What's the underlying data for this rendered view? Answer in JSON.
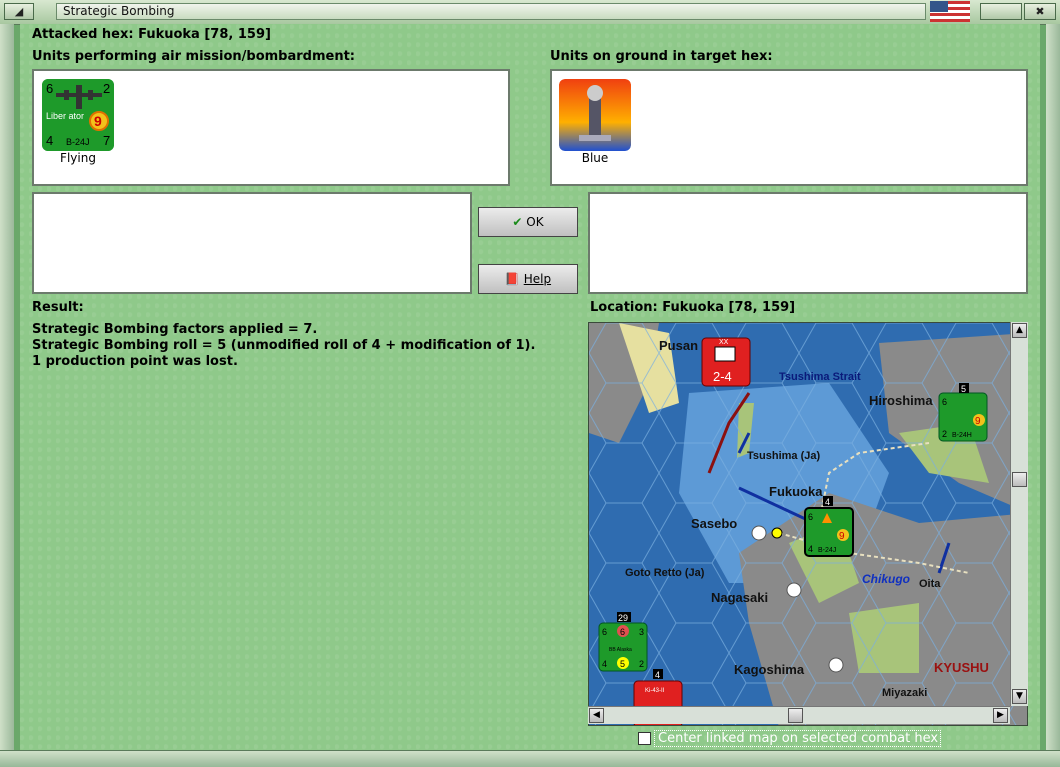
{
  "window": {
    "title": "Strategic Bombing"
  },
  "header": {
    "attacked_hex": "Attacked hex: Fukuoka  [78, 159]"
  },
  "air_units": {
    "label": "Units performing air mission/bombardment:",
    "items": [
      {
        "name": "Liber ator",
        "model": "B-24J",
        "tl": "6",
        "tr": "2",
        "bl": "4",
        "br": "7",
        "badge": "9",
        "caption": "Flying"
      }
    ]
  },
  "ground_units": {
    "label": "Units on ground in target hex:",
    "items": [
      {
        "caption": "Blue"
      }
    ]
  },
  "buttons": {
    "ok": "OK",
    "help": "Help"
  },
  "result": {
    "label": "Result:",
    "lines": [
      "Strategic Bombing factors applied = 7.",
      "Strategic Bombing roll = 5 (unmodified roll of 4 + modification of 1).",
      "1 production point was lost."
    ]
  },
  "location": {
    "label": "Location:  Fukuoka  [78, 159]",
    "map_labels": {
      "pusan": "Pusan",
      "tsushima_strait": "Tsushima Strait",
      "hiroshima": "Hiroshima",
      "tsushima": "Tsushima (Ja)",
      "fukuoka": "Fukuoka",
      "sasebo": "Sasebo",
      "goto": "Goto Retto (Ja)",
      "chikugo": "Chikugo",
      "oita": "Oita",
      "nagasaki": "Nagasaki",
      "kagoshima": "Kagoshima",
      "kyushu": "KYUSHU",
      "miyazaki": "Miyazaki"
    },
    "map_units": {
      "red1": {
        "top": "XX",
        "bottom": "2-4"
      },
      "hiroshima_unit": {
        "stack": "5",
        "tl": "6",
        "badge": "9",
        "bl": "2",
        "model": "B-24H"
      },
      "fukuoka_unit": {
        "stack": "4",
        "tl": "6",
        "badge": "9",
        "bl": "4",
        "model": "B-24J"
      },
      "ship": {
        "stack": "29",
        "tl": "6",
        "mid": "6",
        "tr": "3",
        "name": "BB Alaska",
        "bl": "4",
        "badge": "5",
        "br": "2"
      },
      "red2": {
        "stack": "4",
        "name": "Ki-43-II"
      }
    }
  },
  "options": {
    "center_map_label": "Center linked map on selected combat hex",
    "checked": false
  },
  "colors": {
    "panel_green": "#8fc98a",
    "unit_green": "#1e9a2a",
    "unit_red": "#e02020",
    "sea": "#2f6cb0"
  }
}
